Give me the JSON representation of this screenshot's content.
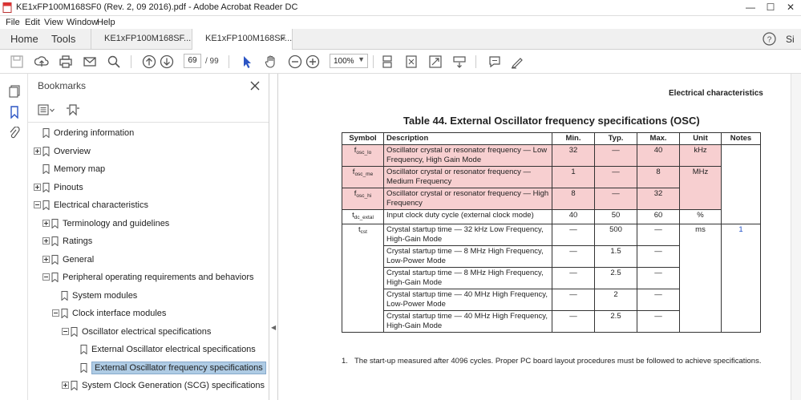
{
  "window": {
    "title": "KE1xFP100M168SF0 (Rev. 2, 09 2016).pdf - Adobe Acrobat Reader DC",
    "minimize": "—",
    "maximize": "☐",
    "close": "✕"
  },
  "menu": [
    "File",
    "Edit",
    "View",
    "Window",
    "Help"
  ],
  "tabs": {
    "home": "Home",
    "tools": "Tools",
    "doc_tab_1": "KE1xFP100M168SF...",
    "doc_tab_2": "KE1xFP100M168SF...",
    "close_glyph": "×",
    "help_glyph": "?",
    "signin": "Si"
  },
  "toolbar": {
    "current_page": "69",
    "page_count": "/ 99",
    "zoom": "100%",
    "zoom_caret": "▼"
  },
  "bookmarks": {
    "header": "Bookmarks",
    "items": [
      {
        "label": "Ordering information",
        "expander": false
      },
      {
        "label": "Overview",
        "expander": "plus"
      },
      {
        "label": "Memory map",
        "expander": false
      },
      {
        "label": "Pinouts",
        "expander": "plus"
      },
      {
        "label": "Electrical characteristics",
        "expander": "minus"
      },
      {
        "label": "Terminology and guidelines",
        "expander": "plus"
      },
      {
        "label": "Ratings",
        "expander": "plus"
      },
      {
        "label": "General",
        "expander": "plus"
      },
      {
        "label": "Peripheral operating requirements and behaviors",
        "expander": "minus"
      },
      {
        "label": "System modules",
        "expander": false
      },
      {
        "label": "Clock interface modules",
        "expander": "minus"
      },
      {
        "label": "Oscillator electrical specifications",
        "expander": "minus"
      },
      {
        "label": "External Oscillator electrical specifications",
        "expander": false
      },
      {
        "label": "External Oscillator frequency specifications",
        "expander": false,
        "selected": true
      },
      {
        "label": "System Clock Generation (SCG) specifications",
        "expander": "plus"
      }
    ]
  },
  "document": {
    "section_header": "Electrical characteristics",
    "table_title": "Table 44.   External Oscillator frequency specifications (OSC)",
    "columns": [
      "Symbol",
      "Description",
      "Min.",
      "Typ.",
      "Max.",
      "Unit",
      "Notes"
    ],
    "rows": {
      "r1": {
        "sym": "f",
        "sub": "osc_lo",
        "desc": "Oscillator crystal or resonator frequency — Low Frequency, High Gain Mode",
        "min": "32",
        "typ": "—",
        "max": "40",
        "unit": "kHz"
      },
      "r2": {
        "sym": "f",
        "sub": "osc_me",
        "desc": "Oscillator crystal or resonator frequency — Medium Frequency",
        "min": "1",
        "typ": "—",
        "max": "8",
        "unit": "MHz"
      },
      "r3": {
        "sym": "f",
        "sub": "osc_hi",
        "desc": "Oscillator crystal or resonator frequency — High Frequency",
        "min": "8",
        "typ": "—",
        "max": "32"
      },
      "r4": {
        "sym": "t",
        "sub": "dc_extal",
        "desc": "Input clock duty cycle (external clock mode)",
        "min": "40",
        "typ": "50",
        "max": "60",
        "unit": "%"
      },
      "r5": {
        "sym": "t",
        "sub": "cst",
        "desc": "Crystal startup time — 32 kHz Low Frequency, High-Gain Mode",
        "min": "—",
        "typ": "500",
        "max": "—",
        "unit": "ms",
        "note": "1"
      },
      "r6": {
        "desc": "Crystal startup time — 8 MHz High Frequency, Low-Power Mode",
        "min": "—",
        "typ": "1.5",
        "max": "—"
      },
      "r7": {
        "desc": "Crystal startup time — 8 MHz High Frequency, High-Gain Mode",
        "min": "—",
        "typ": "2.5",
        "max": "—"
      },
      "r8": {
        "desc": "Crystal startup time — 40 MHz High Frequency, Low-Power Mode",
        "min": "—",
        "typ": "2",
        "max": "—"
      },
      "r9": {
        "desc": "Crystal startup time — 40 MHz High Frequency, High-Gain Mode",
        "min": "—",
        "typ": "2.5",
        "max": "—"
      }
    },
    "footnote_num": "1.",
    "footnote_text": "The start-up measured after 4096 cycles. Proper PC board layout procedures must be followed to achieve specifications."
  },
  "colors": {
    "highlight_row": "#f7cfd0",
    "selected_bookmark": "#aecbe4",
    "link": "#1f4fc7"
  }
}
